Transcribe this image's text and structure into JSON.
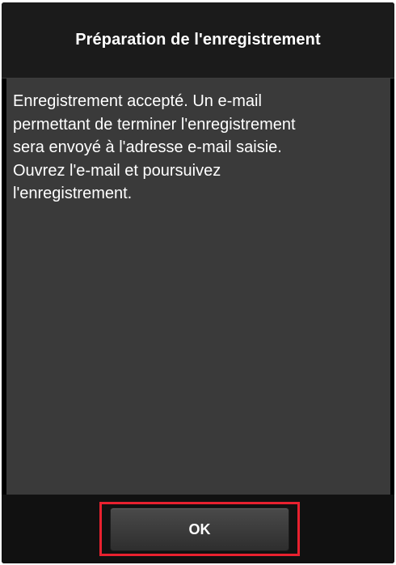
{
  "dialog": {
    "title": "Préparation de l'enregistrement",
    "message": "Enregistrement accepté. Un e-mail\npermettant de terminer l'enregistrement\nsera envoyé à l'adresse e-mail saisie.\nOuvrez l'e-mail et poursuivez\nl'enregistrement.",
    "ok_label": "OK"
  },
  "colors": {
    "background": "#000000",
    "content_panel": "#3a3a3a",
    "text": "#ffffff",
    "highlight": "#e8212f"
  }
}
